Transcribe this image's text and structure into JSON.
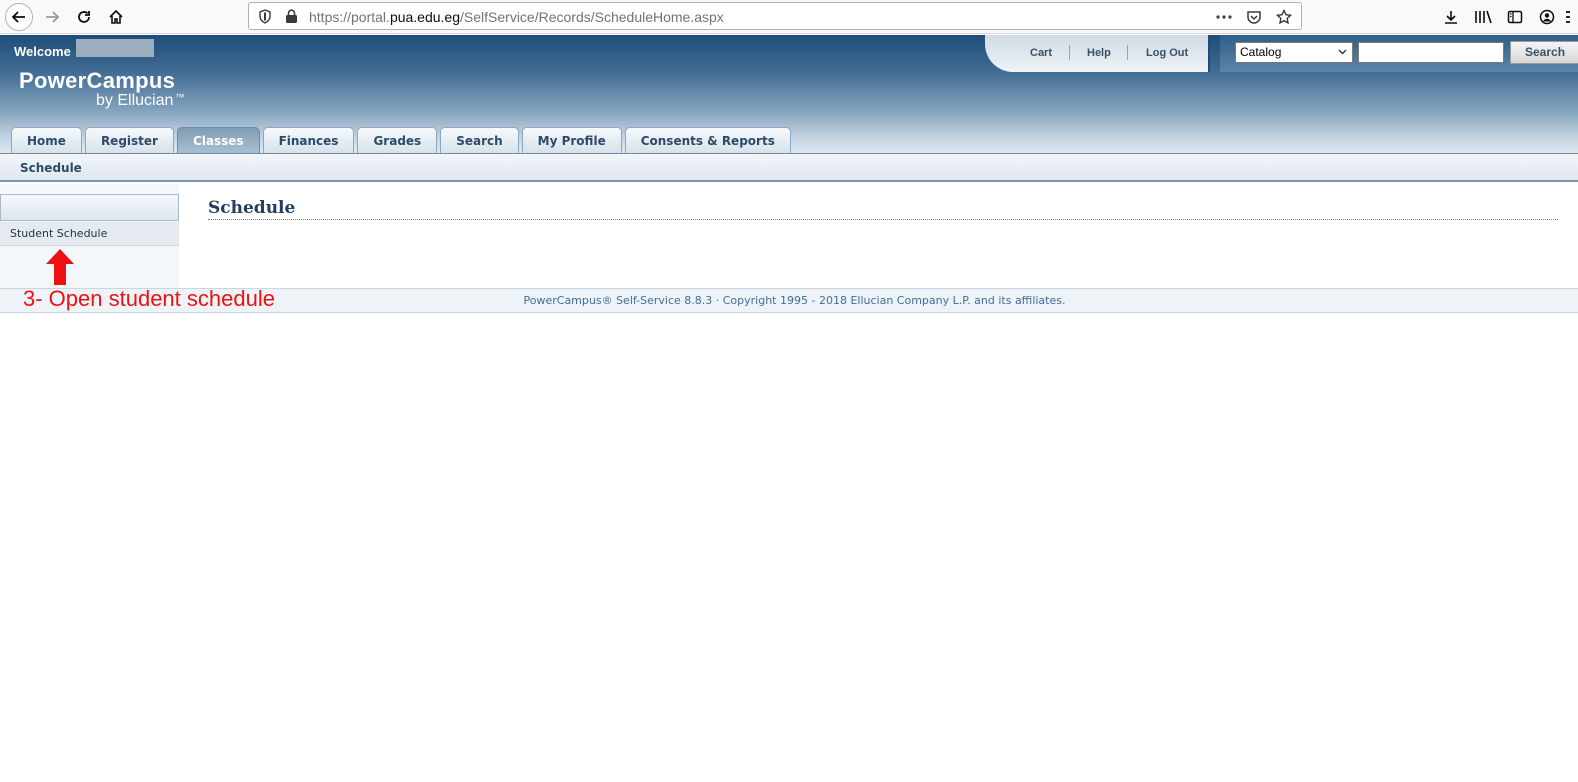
{
  "browser": {
    "url_prefix": "https://portal.",
    "url_domain": "pua.edu.eg",
    "url_path": "/SelfService/Records/ScheduleHome.aspx"
  },
  "header": {
    "welcome_label": "Welcome",
    "logo_main": "PowerCampus",
    "logo_sub": "by Ellucian",
    "logo_tm": "™",
    "util_links": [
      "Cart",
      "Help",
      "Log Out"
    ],
    "search_select_value": "Catalog",
    "search_button": "Search"
  },
  "tabs": [
    {
      "label": "Home",
      "active": false
    },
    {
      "label": "Register",
      "active": false
    },
    {
      "label": "Classes",
      "active": true
    },
    {
      "label": "Finances",
      "active": false
    },
    {
      "label": "Grades",
      "active": false
    },
    {
      "label": "Search",
      "active": false
    },
    {
      "label": "My Profile",
      "active": false
    },
    {
      "label": "Consents & Reports",
      "active": false
    }
  ],
  "subnav": {
    "label": "Schedule"
  },
  "sidebar": {
    "items": [
      {
        "label": "Student Schedule"
      }
    ]
  },
  "main": {
    "title": "Schedule"
  },
  "annotation": {
    "text": "3- Open student schedule",
    "color": "#ee1111"
  },
  "footer": {
    "text": "PowerCampus® Self-Service 8.8.3 · Copyright 1995 - 2018 Ellucian Company L.P. and its affiliates."
  }
}
